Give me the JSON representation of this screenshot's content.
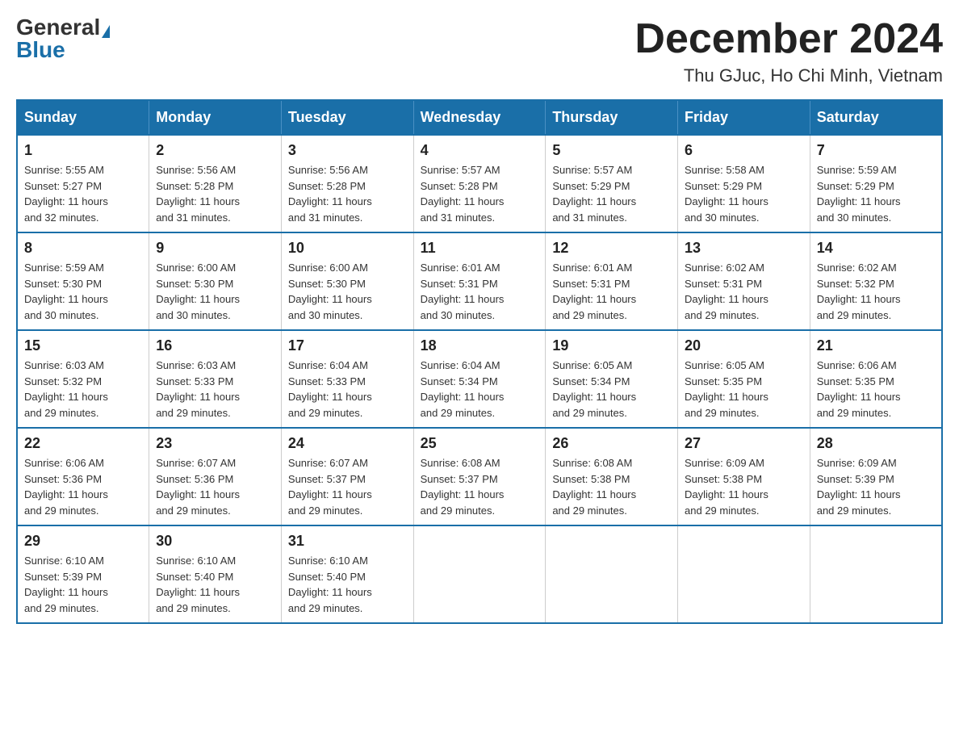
{
  "header": {
    "logo_general": "General",
    "logo_blue": "Blue",
    "month_title": "December 2024",
    "subtitle": "Thu GJuc, Ho Chi Minh, Vietnam"
  },
  "days_of_week": [
    "Sunday",
    "Monday",
    "Tuesday",
    "Wednesday",
    "Thursday",
    "Friday",
    "Saturday"
  ],
  "weeks": [
    [
      {
        "day": "1",
        "sunrise": "5:55 AM",
        "sunset": "5:27 PM",
        "daylight": "11 hours and 32 minutes."
      },
      {
        "day": "2",
        "sunrise": "5:56 AM",
        "sunset": "5:28 PM",
        "daylight": "11 hours and 31 minutes."
      },
      {
        "day": "3",
        "sunrise": "5:56 AM",
        "sunset": "5:28 PM",
        "daylight": "11 hours and 31 minutes."
      },
      {
        "day": "4",
        "sunrise": "5:57 AM",
        "sunset": "5:28 PM",
        "daylight": "11 hours and 31 minutes."
      },
      {
        "day": "5",
        "sunrise": "5:57 AM",
        "sunset": "5:29 PM",
        "daylight": "11 hours and 31 minutes."
      },
      {
        "day": "6",
        "sunrise": "5:58 AM",
        "sunset": "5:29 PM",
        "daylight": "11 hours and 30 minutes."
      },
      {
        "day": "7",
        "sunrise": "5:59 AM",
        "sunset": "5:29 PM",
        "daylight": "11 hours and 30 minutes."
      }
    ],
    [
      {
        "day": "8",
        "sunrise": "5:59 AM",
        "sunset": "5:30 PM",
        "daylight": "11 hours and 30 minutes."
      },
      {
        "day": "9",
        "sunrise": "6:00 AM",
        "sunset": "5:30 PM",
        "daylight": "11 hours and 30 minutes."
      },
      {
        "day": "10",
        "sunrise": "6:00 AM",
        "sunset": "5:30 PM",
        "daylight": "11 hours and 30 minutes."
      },
      {
        "day": "11",
        "sunrise": "6:01 AM",
        "sunset": "5:31 PM",
        "daylight": "11 hours and 30 minutes."
      },
      {
        "day": "12",
        "sunrise": "6:01 AM",
        "sunset": "5:31 PM",
        "daylight": "11 hours and 29 minutes."
      },
      {
        "day": "13",
        "sunrise": "6:02 AM",
        "sunset": "5:31 PM",
        "daylight": "11 hours and 29 minutes."
      },
      {
        "day": "14",
        "sunrise": "6:02 AM",
        "sunset": "5:32 PM",
        "daylight": "11 hours and 29 minutes."
      }
    ],
    [
      {
        "day": "15",
        "sunrise": "6:03 AM",
        "sunset": "5:32 PM",
        "daylight": "11 hours and 29 minutes."
      },
      {
        "day": "16",
        "sunrise": "6:03 AM",
        "sunset": "5:33 PM",
        "daylight": "11 hours and 29 minutes."
      },
      {
        "day": "17",
        "sunrise": "6:04 AM",
        "sunset": "5:33 PM",
        "daylight": "11 hours and 29 minutes."
      },
      {
        "day": "18",
        "sunrise": "6:04 AM",
        "sunset": "5:34 PM",
        "daylight": "11 hours and 29 minutes."
      },
      {
        "day": "19",
        "sunrise": "6:05 AM",
        "sunset": "5:34 PM",
        "daylight": "11 hours and 29 minutes."
      },
      {
        "day": "20",
        "sunrise": "6:05 AM",
        "sunset": "5:35 PM",
        "daylight": "11 hours and 29 minutes."
      },
      {
        "day": "21",
        "sunrise": "6:06 AM",
        "sunset": "5:35 PM",
        "daylight": "11 hours and 29 minutes."
      }
    ],
    [
      {
        "day": "22",
        "sunrise": "6:06 AM",
        "sunset": "5:36 PM",
        "daylight": "11 hours and 29 minutes."
      },
      {
        "day": "23",
        "sunrise": "6:07 AM",
        "sunset": "5:36 PM",
        "daylight": "11 hours and 29 minutes."
      },
      {
        "day": "24",
        "sunrise": "6:07 AM",
        "sunset": "5:37 PM",
        "daylight": "11 hours and 29 minutes."
      },
      {
        "day": "25",
        "sunrise": "6:08 AM",
        "sunset": "5:37 PM",
        "daylight": "11 hours and 29 minutes."
      },
      {
        "day": "26",
        "sunrise": "6:08 AM",
        "sunset": "5:38 PM",
        "daylight": "11 hours and 29 minutes."
      },
      {
        "day": "27",
        "sunrise": "6:09 AM",
        "sunset": "5:38 PM",
        "daylight": "11 hours and 29 minutes."
      },
      {
        "day": "28",
        "sunrise": "6:09 AM",
        "sunset": "5:39 PM",
        "daylight": "11 hours and 29 minutes."
      }
    ],
    [
      {
        "day": "29",
        "sunrise": "6:10 AM",
        "sunset": "5:39 PM",
        "daylight": "11 hours and 29 minutes."
      },
      {
        "day": "30",
        "sunrise": "6:10 AM",
        "sunset": "5:40 PM",
        "daylight": "11 hours and 29 minutes."
      },
      {
        "day": "31",
        "sunrise": "6:10 AM",
        "sunset": "5:40 PM",
        "daylight": "11 hours and 29 minutes."
      },
      null,
      null,
      null,
      null
    ]
  ],
  "labels": {
    "sunrise": "Sunrise:",
    "sunset": "Sunset:",
    "daylight": "Daylight:"
  }
}
